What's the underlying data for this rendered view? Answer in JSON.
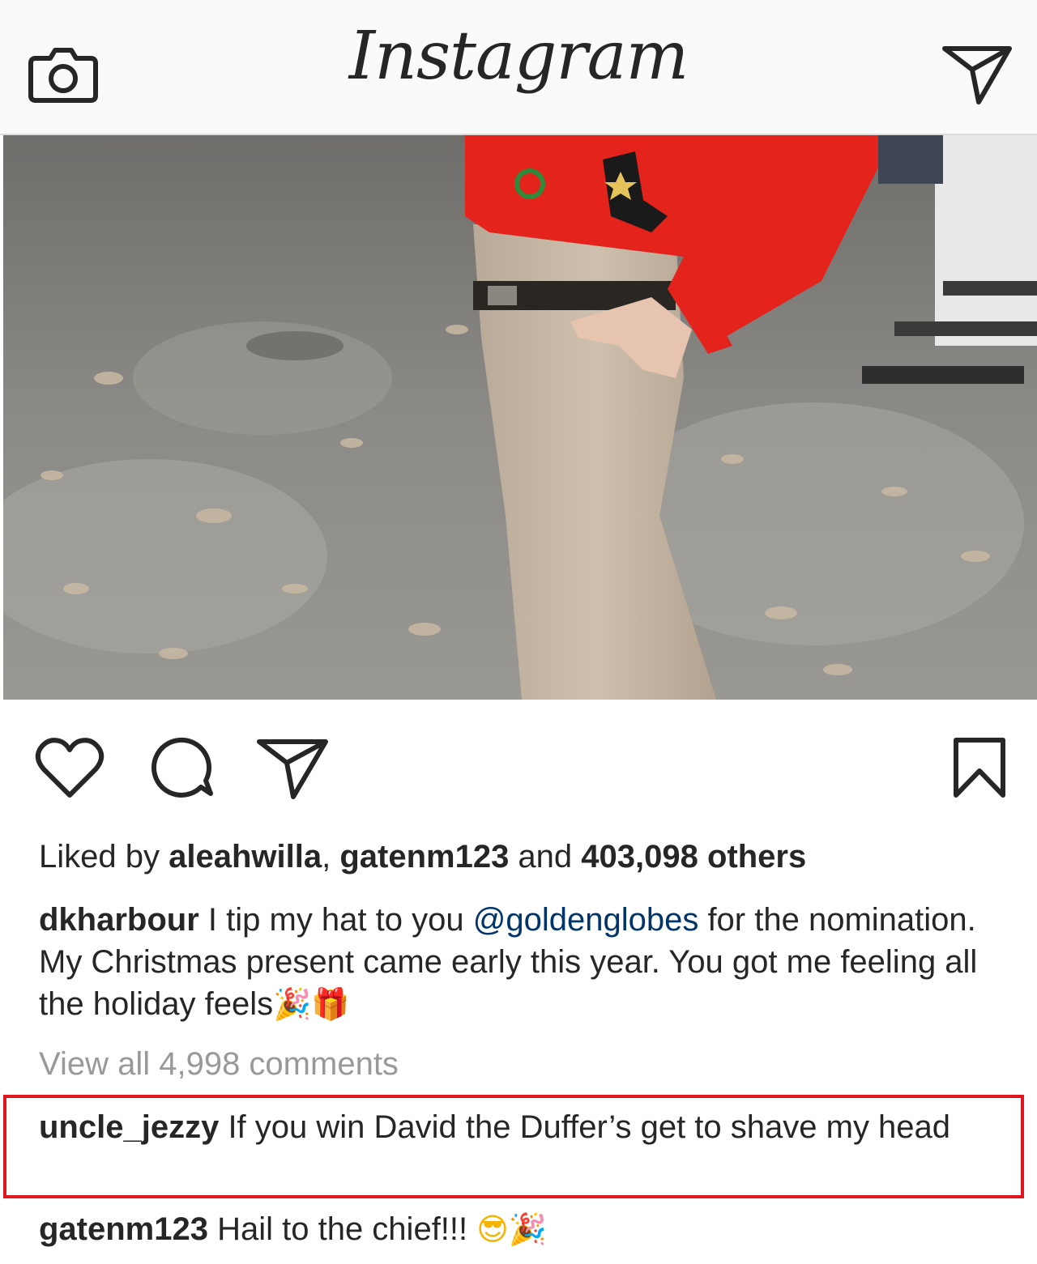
{
  "header": {
    "logo": "Instagram",
    "camera_icon": "camera-icon",
    "direct_icon": "paper-plane-icon"
  },
  "post": {
    "image_alt": "Person in red holiday sweater and khaki pants standing on leaf-covered pavement",
    "actions": {
      "like_icon": "heart-icon",
      "comment_icon": "comment-bubble-icon",
      "share_icon": "paper-plane-icon",
      "save_icon": "bookmark-icon"
    },
    "likes": {
      "prefix": "Liked by ",
      "user1": "aleahwilla",
      "sep": ", ",
      "user2": "gatenm123",
      "and": " and ",
      "others": "403,098 others"
    },
    "caption": {
      "username": "dkharbour",
      "text_before": " I tip my hat to you ",
      "mention": "@goldenglobes",
      "text_after": " for the nomination.  My Christmas present came early this year. You got me feeling all the holiday feels",
      "emoji1": "🎉",
      "emoji2": "🎁"
    },
    "view_all_comments": "View all 4,998 comments",
    "comments": [
      {
        "username": "uncle_jezzy",
        "text": " If you win David the Duffer’s get to shave my head"
      },
      {
        "username": "gatenm123",
        "text": " Hail to the chief!!! ",
        "emoji1": "😎",
        "emoji2": "🎉"
      }
    ]
  },
  "colors": {
    "text": "#262626",
    "muted": "#999999",
    "mention": "#003569",
    "highlight": "#e0151d",
    "header_bg": "#fafafa"
  }
}
